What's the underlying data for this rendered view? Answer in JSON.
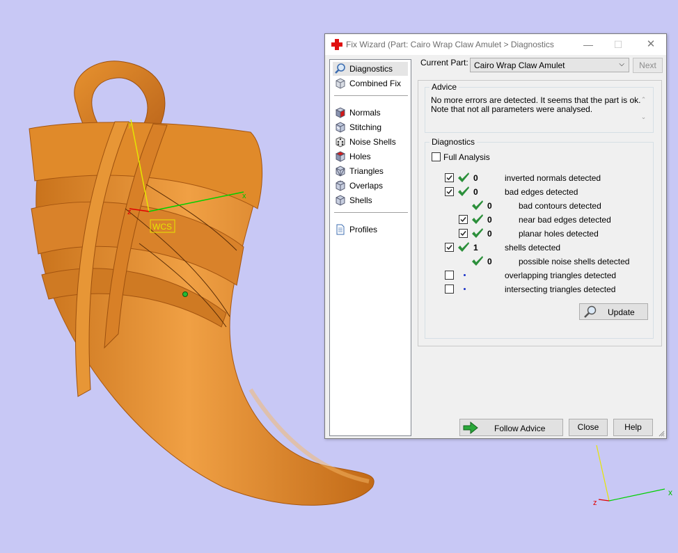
{
  "window": {
    "title": "Fix Wizard (Part: Cairo Wrap Claw Amulet > Diagnostics",
    "controls": {
      "minimize": "—",
      "maximize": "☐",
      "close": "✕"
    }
  },
  "viewport": {
    "wcs_label": "WCS",
    "axes": {
      "x": "x",
      "y": "y",
      "z": "z"
    }
  },
  "nav": {
    "items": [
      {
        "label": "Diagnostics",
        "icon": "magnifier-icon",
        "selected": true
      },
      {
        "label": "Combined Fix",
        "icon": "cube-icon"
      },
      {
        "label": "Normals",
        "icon": "cube-red-face-icon"
      },
      {
        "label": "Stitching",
        "icon": "cube-stitch-icon"
      },
      {
        "label": "Noise Shells",
        "icon": "dice-icon"
      },
      {
        "label": "Holes",
        "icon": "cube-hole-icon"
      },
      {
        "label": "Triangles",
        "icon": "cube-triangles-icon"
      },
      {
        "label": "Overlaps",
        "icon": "cube-overlap-icon"
      },
      {
        "label": "Shells",
        "icon": "cube-shell-icon"
      },
      {
        "label": "Profiles",
        "icon": "document-icon"
      }
    ]
  },
  "current_part": {
    "label": "Current Part:",
    "value": "Cairo Wrap Claw Amulet",
    "next_label": "Next"
  },
  "advice": {
    "legend": "Advice",
    "lines": [
      "No more errors are detected. It seems that the part is ok.",
      "Note that not all parameters were analysed."
    ]
  },
  "diagnostics": {
    "legend": "Diagnostics",
    "full_analysis_label": "Full Analysis",
    "rows": [
      {
        "checked": true,
        "status": "ok",
        "count": "0",
        "text": "inverted normals detected",
        "indent": 0
      },
      {
        "checked": true,
        "status": "ok",
        "count": "0",
        "text": "bad edges detected",
        "indent": 0
      },
      {
        "checked": null,
        "status": "ok",
        "count": "0",
        "text": "bad contours detected",
        "indent": 1
      },
      {
        "checked": true,
        "status": "ok",
        "count": "0",
        "text": "near bad edges detected",
        "indent": 1
      },
      {
        "checked": true,
        "status": "ok",
        "count": "0",
        "text": "planar holes detected",
        "indent": 1
      },
      {
        "checked": true,
        "status": "ok",
        "count": "1",
        "text": "shells detected",
        "indent": 0
      },
      {
        "checked": null,
        "status": "ok",
        "count": "0",
        "text": "possible noise shells detected",
        "indent": 1
      },
      {
        "checked": false,
        "status": "none",
        "count": "",
        "text": "overlapping triangles detected",
        "indent": 0
      },
      {
        "checked": false,
        "status": "none",
        "count": "",
        "text": "intersecting triangles detected",
        "indent": 0
      }
    ],
    "update_label": "Update"
  },
  "footer": {
    "follow_label": "Follow Advice",
    "close_label": "Close",
    "help_label": "Help"
  },
  "colors": {
    "background": "#c8c8f5",
    "model": "#e0892a",
    "model_dark": "#a8560d",
    "check_green": "#2b8f3a",
    "dot_blue": "#1a32c8",
    "axis_x": "#00d000",
    "axis_y": "#e6e600",
    "axis_z": "#e00000"
  }
}
